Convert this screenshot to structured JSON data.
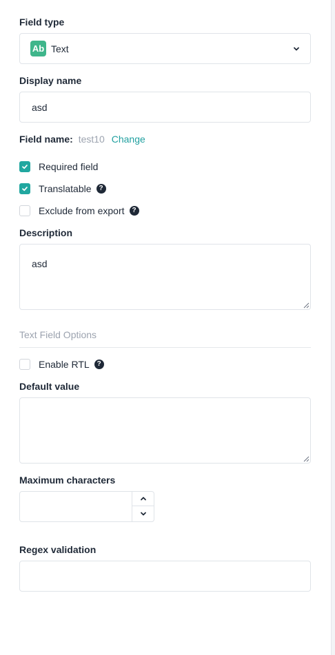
{
  "field_type": {
    "label": "Field type",
    "badge": "Ab",
    "value": "Text",
    "badge_color": "#3fb68b"
  },
  "display_name": {
    "label": "Display name",
    "value": "asd"
  },
  "field_name": {
    "label": "Field name:",
    "value": "test10",
    "change_link": "Change"
  },
  "checkboxes": {
    "required": {
      "label": "Required field",
      "checked": true
    },
    "translatable": {
      "label": "Translatable",
      "checked": true
    },
    "exclude_export": {
      "label": "Exclude from export",
      "checked": false
    }
  },
  "description": {
    "label": "Description",
    "value": "asd"
  },
  "text_options": {
    "section_title": "Text Field Options",
    "enable_rtl": {
      "label": "Enable RTL",
      "checked": false
    }
  },
  "default_value": {
    "label": "Default value",
    "value": ""
  },
  "max_chars": {
    "label": "Maximum characters",
    "value": ""
  },
  "regex": {
    "label": "Regex validation",
    "value": ""
  },
  "colors": {
    "accent": "#21a7a0",
    "link": "#21a0a0"
  },
  "icons": {
    "help": "?"
  }
}
